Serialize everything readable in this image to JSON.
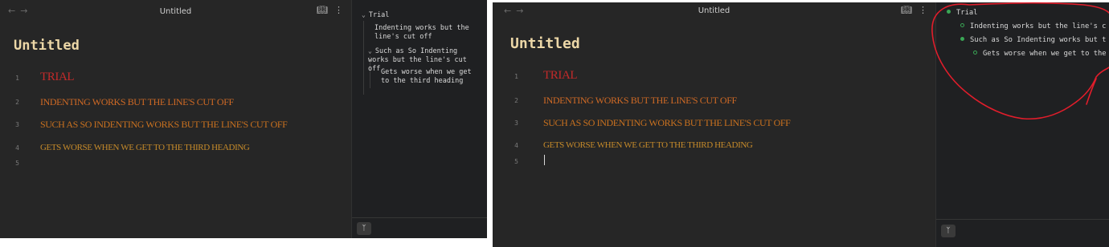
{
  "windows": [
    {
      "tab_title": "Untitled",
      "nav": {
        "back": "←",
        "forward": "→"
      },
      "icons": {
        "reading_view": "book-open-icon",
        "more": "more-vertical-icon"
      },
      "doc_title": "Untitled",
      "lines": [
        {
          "num": "1",
          "text": "Trial"
        },
        {
          "num": "2",
          "text": "Indenting works but the line's cut off"
        },
        {
          "num": "3",
          "text": "Such as So Indenting works but the line's cut off"
        },
        {
          "num": "4",
          "text": "Gets worse when we get to the third heading"
        },
        {
          "num": "5",
          "text": ""
        }
      ],
      "outline": [
        {
          "text": "Trial"
        },
        {
          "text": "Indenting works but the line's cut off"
        },
        {
          "text": "Such as So Indenting works but the line's cut off"
        },
        {
          "text": "Gets worse when we get to the third heading"
        }
      ],
      "footer_icon": "graph-icon"
    },
    {
      "tab_title": "Untitled",
      "nav": {
        "back": "←",
        "forward": "→"
      },
      "icons": {
        "reading_view": "book-open-icon",
        "more": "more-vertical-icon"
      },
      "doc_title": "Untitled",
      "lines": [
        {
          "num": "1",
          "text": "Trial"
        },
        {
          "num": "2",
          "text": "Indenting works but the line's cut off"
        },
        {
          "num": "3",
          "text": "Such as So Indenting works but the line's cut off"
        },
        {
          "num": "4",
          "text": "Gets worse when we get to the third heading"
        },
        {
          "num": "5",
          "text": ""
        }
      ],
      "outline": [
        {
          "text": "Trial"
        },
        {
          "text": "Indenting works but the line's c"
        },
        {
          "text": "Such as So Indenting works but t"
        },
        {
          "text": "Gets worse when we get to the"
        }
      ],
      "footer_icon": "graph-icon"
    }
  ],
  "colors": {
    "background": "#262626",
    "sidebar": "#1f2022",
    "title": "#ecd7a7",
    "heading1": "#c42a2a",
    "heading2": "#d06a25",
    "heading3": "#c9711f",
    "heading4": "#c58a2a",
    "bullet": "#3aa655",
    "annotation": "#e11d2b"
  }
}
